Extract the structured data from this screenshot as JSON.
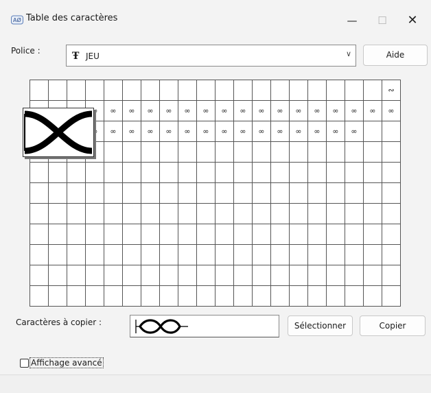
{
  "window": {
    "title": "Table des caractères",
    "minimize_glyph": "—",
    "maximize_glyph": "☐",
    "close_glyph": "✕"
  },
  "font": {
    "label": "Police :",
    "selected": "JEU",
    "font_icon_glyph": "Ŧ",
    "dropdown_glyph": "∨"
  },
  "buttons": {
    "aide": "Aide",
    "select": "Sélectionner",
    "copy": "Copier"
  },
  "grid": {
    "rows": [
      [
        "",
        "",
        "",
        "",
        "",
        "",
        "",
        "",
        "",
        "",
        "",
        "",
        "",
        "",
        "",
        "",
        "",
        "",
        "",
        "∾"
      ],
      [
        "∞",
        "∞",
        "∞",
        "∞",
        "∞",
        "∞",
        "∞",
        "∞",
        "∞",
        "∞",
        "∞",
        "∞",
        "∞",
        "∞",
        "∞",
        "∞",
        "∞",
        "∞",
        "∞",
        "∞"
      ],
      [
        "∞",
        "∞",
        "∞",
        "∞",
        "∞",
        "∞",
        "∞",
        "∞",
        "∞",
        "∞",
        "∞",
        "∞",
        "∞",
        "∞",
        "∞",
        "∞",
        "∞",
        "∞",
        "",
        ""
      ],
      [
        "",
        "",
        "",
        "",
        "",
        "",
        "",
        "",
        "",
        "",
        "",
        "",
        "",
        "",
        "",
        "",
        "",
        "",
        "",
        ""
      ],
      [
        "",
        "",
        "",
        "",
        "",
        "",
        "",
        "",
        "",
        "",
        "",
        "",
        "",
        "",
        "",
        "",
        "",
        "",
        "",
        ""
      ],
      [
        "",
        "",
        "",
        "",
        "",
        "",
        "",
        "",
        "",
        "",
        "",
        "",
        "",
        "",
        "",
        "",
        "",
        "",
        "",
        ""
      ],
      [
        "",
        "",
        "",
        "",
        "",
        "",
        "",
        "",
        "",
        "",
        "",
        "",
        "",
        "",
        "",
        "",
        "",
        "",
        "",
        ""
      ],
      [
        "",
        "",
        "",
        "",
        "",
        "",
        "",
        "",
        "",
        "",
        "",
        "",
        "",
        "",
        "",
        "",
        "",
        "",
        "",
        ""
      ],
      [
        "",
        "",
        "",
        "",
        "",
        "",
        "",
        "",
        "",
        "",
        "",
        "",
        "",
        "",
        "",
        "",
        "",
        "",
        "",
        ""
      ],
      [
        "",
        "",
        "",
        "",
        "",
        "",
        "",
        "",
        "",
        "",
        "",
        "",
        "",
        "",
        "",
        "",
        "",
        "",
        "",
        ""
      ],
      [
        "",
        "",
        "",
        "",
        "",
        "",
        "",
        "",
        "",
        "",
        "",
        "",
        "",
        "",
        "",
        "",
        "",
        "",
        "",
        ""
      ]
    ]
  },
  "copy": {
    "label": "Caractères à copier :"
  },
  "advanced": {
    "label": "Affichage avancé",
    "checked": false
  }
}
